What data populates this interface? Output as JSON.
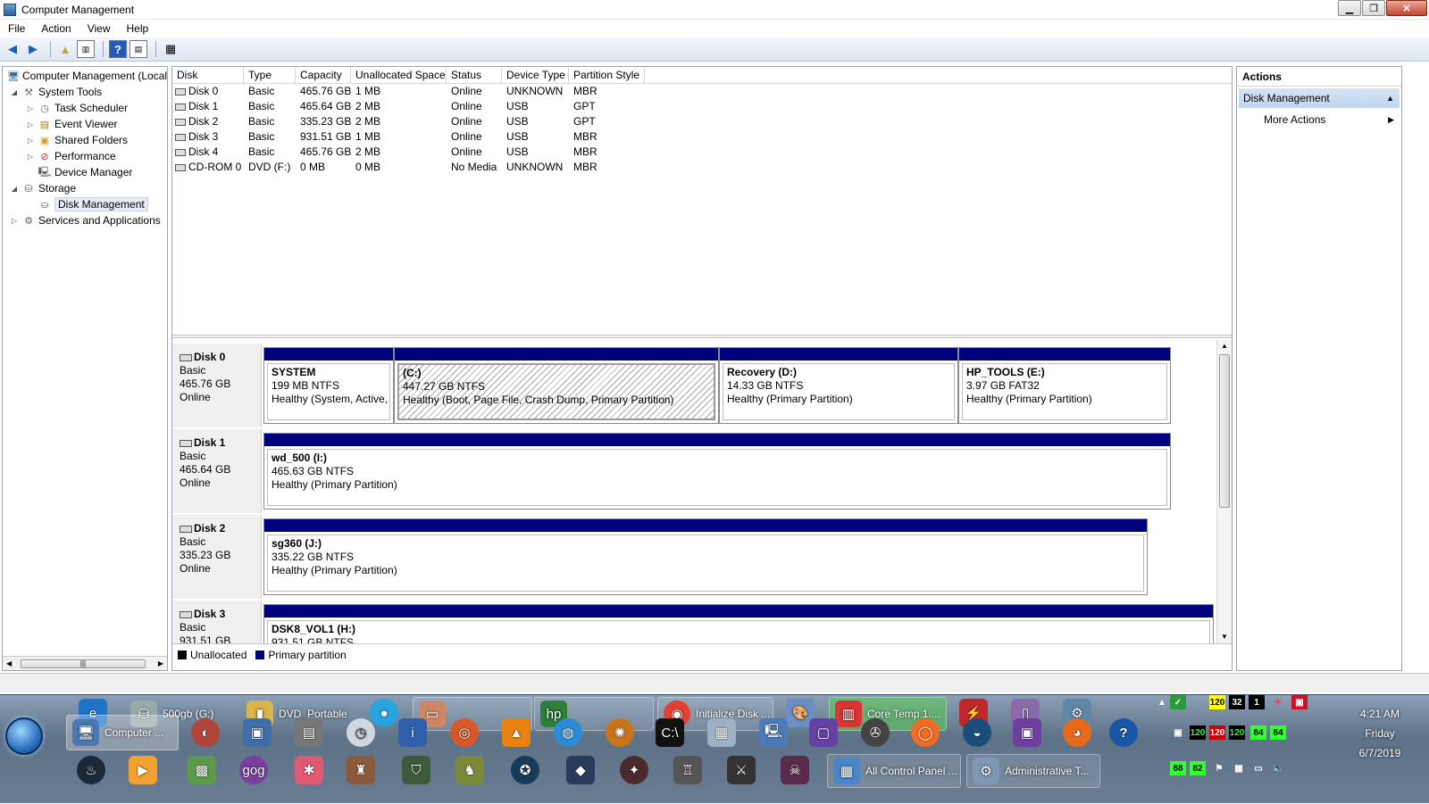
{
  "window": {
    "title": "Computer Management"
  },
  "menu": [
    "File",
    "Action",
    "View",
    "Help"
  ],
  "tree": [
    {
      "label": "Computer Management (Local",
      "level": 0,
      "icon": "computer-icon",
      "expander": ""
    },
    {
      "label": "System Tools",
      "level": 1,
      "icon": "tools-icon",
      "expander": "◢"
    },
    {
      "label": "Task Scheduler",
      "level": 2,
      "icon": "clock-icon",
      "expander": "▷"
    },
    {
      "label": "Event Viewer",
      "level": 2,
      "icon": "event-viewer-icon",
      "expander": "▷"
    },
    {
      "label": "Shared Folders",
      "level": 2,
      "icon": "shared-folders-icon",
      "expander": "▷"
    },
    {
      "label": "Performance",
      "level": 2,
      "icon": "performance-icon",
      "expander": "▷"
    },
    {
      "label": "Device Manager",
      "level": 2,
      "icon": "device-manager-icon",
      "expander": ""
    },
    {
      "label": "Storage",
      "level": 1,
      "icon": "storage-icon",
      "expander": "◢"
    },
    {
      "label": "Disk Management",
      "level": 2,
      "icon": "disk-management-icon",
      "expander": "",
      "selected": true
    },
    {
      "label": "Services and Applications",
      "level": 1,
      "icon": "services-icon",
      "expander": "▷"
    }
  ],
  "volume_list": {
    "columns": [
      "Disk",
      "Type",
      "Capacity",
      "Unallocated Space",
      "Status",
      "Device Type",
      "Partition Style"
    ],
    "rows": [
      [
        "Disk 0",
        "Basic",
        "465.76 GB",
        "1 MB",
        "Online",
        "UNKNOWN",
        "MBR"
      ],
      [
        "Disk 1",
        "Basic",
        "465.64 GB",
        "2 MB",
        "Online",
        "USB",
        "GPT"
      ],
      [
        "Disk 2",
        "Basic",
        "335.23 GB",
        "2 MB",
        "Online",
        "USB",
        "GPT"
      ],
      [
        "Disk 3",
        "Basic",
        "931.51 GB",
        "1 MB",
        "Online",
        "USB",
        "MBR"
      ],
      [
        "Disk 4",
        "Basic",
        "465.76 GB",
        "2 MB",
        "Online",
        "USB",
        "MBR"
      ],
      [
        "CD-ROM 0",
        "DVD (F:)",
        "0 MB",
        "0 MB",
        "No Media",
        "UNKNOWN",
        "MBR"
      ]
    ]
  },
  "disks": [
    {
      "name": "Disk 0",
      "type": "Basic",
      "size": "465.76 GB",
      "status": "Online",
      "partitions": [
        {
          "name": "SYSTEM",
          "fs": "199 MB NTFS",
          "health": "Healthy (System, Active, Primary Partition)"
        },
        {
          "name": "(C:)",
          "fs": "447.27 GB NTFS",
          "health": "Healthy (Boot, Page File, Crash Dump, Primary Partition)",
          "selected": true
        },
        {
          "name": "Recovery  (D:)",
          "fs": "14.33 GB NTFS",
          "health": "Healthy (Primary Partition)"
        },
        {
          "name": "HP_TOOLS  (E:)",
          "fs": "3.97 GB FAT32",
          "health": "Healthy (Primary Partition)"
        }
      ]
    },
    {
      "name": "Disk 1",
      "type": "Basic",
      "size": "465.64 GB",
      "status": "Online",
      "partitions": [
        {
          "name": "wd_500  (I:)",
          "fs": "465.63 GB NTFS",
          "health": "Healthy (Primary Partition)"
        }
      ]
    },
    {
      "name": "Disk 2",
      "type": "Basic",
      "size": "335.23 GB",
      "status": "Online",
      "partitions": [
        {
          "name": "sg360  (J:)",
          "fs": "335.22 GB NTFS",
          "health": "Healthy (Primary Partition)"
        }
      ]
    },
    {
      "name": "Disk 3",
      "type": "Basic",
      "size": "931.51 GB",
      "status": "",
      "partitions": [
        {
          "name": "DSK8_VOL1  (H:)",
          "fs": "931.51 GB NTFS",
          "health": ""
        }
      ]
    }
  ],
  "legend": [
    {
      "label": "Unallocated",
      "color": "#000000"
    },
    {
      "label": "Primary partition",
      "color": "#00007f"
    }
  ],
  "actions": {
    "header": "Actions",
    "section": "Disk Management",
    "items": [
      "More Actions"
    ]
  },
  "taskbar": {
    "row1": [
      "500gb (G:)",
      "DVD_Portable",
      "Initialize Disk ...",
      "Core Temp 1...."
    ],
    "row2": [
      "Computer ..."
    ],
    "row3": [
      "All Control Panel ...",
      "Administrative T..."
    ]
  },
  "tray": {
    "temps": [
      "120",
      "32",
      "1",
      "120",
      "120",
      "120",
      "84",
      "84",
      "88",
      "82"
    ]
  },
  "clock": {
    "time": "4:21 AM",
    "day": "Friday",
    "date": "6/7/2019"
  },
  "colors": {
    "primary_partition": "#00007f",
    "selection": "#e5ecf5"
  }
}
